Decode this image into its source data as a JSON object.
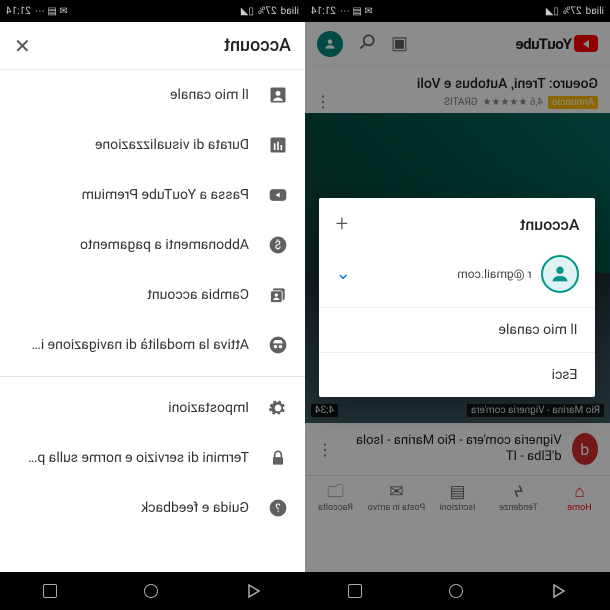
{
  "statusbar": {
    "carrier": "iliad",
    "time": "21:14",
    "battery": "27%"
  },
  "left": {
    "logo_text": "YouTube",
    "ad": {
      "title": "Goeuro: Treni, Autobus e Voli",
      "badge": "Annuncio",
      "rating": "4,6 ★★★★★",
      "tag": "GRATIS"
    },
    "video2": {
      "caption": "Rio Marina - Vigneria com'era",
      "duration": "4:34",
      "channel_initial": "d",
      "title": "Vigneria com'era - Rio Marina - Isola d'Elba - IT"
    },
    "bottomnav": {
      "items": [
        {
          "label": "Home"
        },
        {
          "label": "Tendenze"
        },
        {
          "label": "Iscrizioni"
        },
        {
          "label": "Posta in arrivo"
        },
        {
          "label": "Raccolta"
        }
      ]
    },
    "sheet": {
      "title": "Account",
      "email": "r             @gmail.com",
      "my_channel": "Il mio canale",
      "logout": "Esci"
    }
  },
  "right": {
    "title": "Account",
    "items_a": [
      {
        "icon": "account-box-icon",
        "label": "Il mio canale"
      },
      {
        "icon": "bar-chart-icon",
        "label": "Durata di visualizzazione"
      },
      {
        "icon": "youtube-icon",
        "label": "Passa a YouTube Premium"
      },
      {
        "icon": "dollar-icon",
        "label": "Abbonamenti a pagamento"
      },
      {
        "icon": "switch-account-icon",
        "label": "Cambia account"
      },
      {
        "icon": "incognito-icon",
        "label": "Attiva la modalità di navigazione i…"
      }
    ],
    "items_b": [
      {
        "icon": "gear-icon",
        "label": "Impostazioni"
      },
      {
        "icon": "lock-icon",
        "label": "Termini di servizio e norme sulla p…"
      },
      {
        "icon": "help-icon",
        "label": "Guida e feedback"
      }
    ]
  }
}
